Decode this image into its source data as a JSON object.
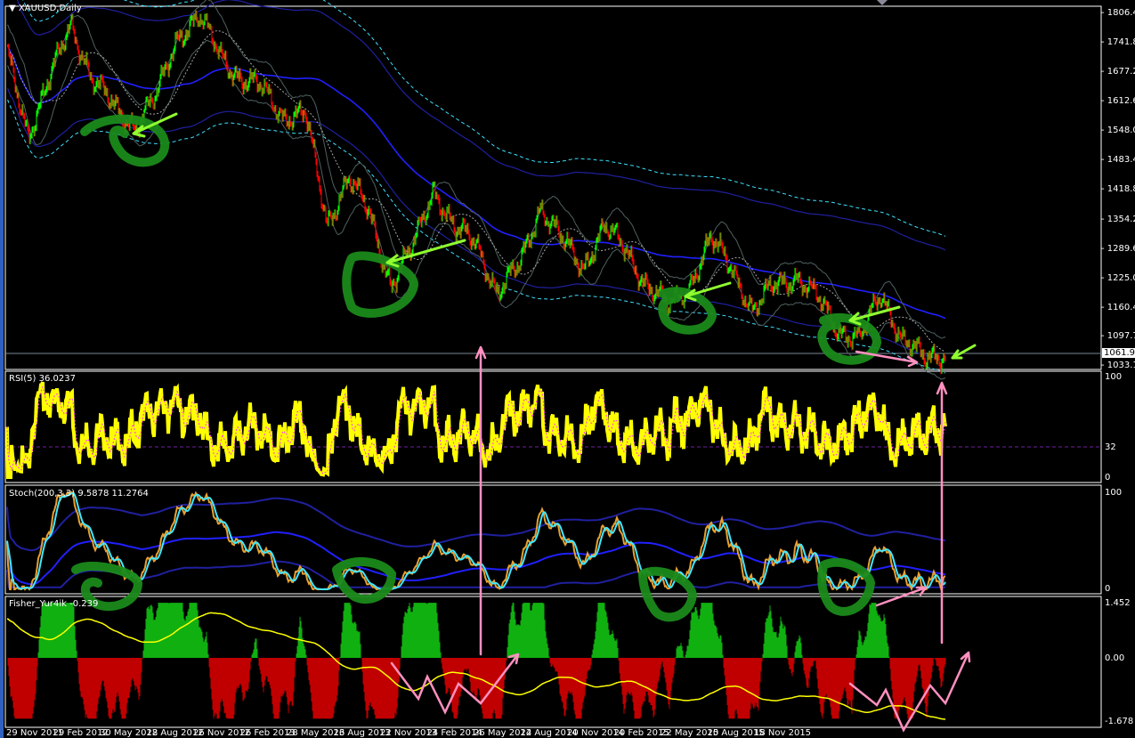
{
  "window": {
    "title": "XAUUSD,Daily"
  },
  "panels": {
    "rsi": {
      "label": "RSI(5) 36.0237",
      "axis": [
        "100",
        "32",
        "0"
      ]
    },
    "stoch": {
      "label": "Stoch(200,3,3) 9.5878 11.2764",
      "axis": [
        "100",
        "0"
      ]
    },
    "fisher": {
      "label": "Fisher_Yur4ik -0.239",
      "axis": [
        "1.452",
        "0.00",
        "-1.678"
      ]
    }
  },
  "colors": {
    "bull": "#00ff00",
    "bear": "#ff0000",
    "rsi": "#ffff00",
    "stoch_main": "#e8a030",
    "stoch_signal": "#40e8ff",
    "ma": "#2020ff",
    "envelope": "#40e0ff",
    "fisher_pos": "#10b010",
    "fisher_neg": "#c00000",
    "annotation_circle": "#1a8a1a",
    "annotation_arrow_green": "#90ff30",
    "annotation_arrow_pink": "#ff90c0"
  },
  "chart_data": {
    "type": "candlestick",
    "symbol": "XAUUSD",
    "timeframe": "Daily",
    "current_price": "1061.95",
    "price_axis": [
      "1806.40",
      "1741.80",
      "1677.20",
      "1612.60",
      "1548.00",
      "1483.40",
      "1418.80",
      "1354.20",
      "1289.60",
      "1225.00",
      "1160.40",
      "1097.70",
      "1033.10"
    ],
    "ylim": [
      1033.1,
      1806.4
    ],
    "time_axis": [
      "29 Nov 2011",
      "29 Feb 2012",
      "30 May 2012",
      "28 Aug 2012",
      "26 Nov 2012",
      "26 Feb 2013",
      "28 May 2013",
      "26 Aug 2013",
      "22 Nov 2013",
      "24 Feb 2014",
      "26 May 2014",
      "22 Aug 2014",
      "20 Nov 2014",
      "20 Feb 2015",
      "22 May 2015",
      "20 Aug 2015",
      "18 Nov 2015"
    ],
    "approx_closes": [
      [
        "29 Nov 2011",
        1718
      ],
      [
        "Dec 2011",
        1543
      ],
      [
        "Jan 2012",
        1660
      ],
      [
        "Feb 2012",
        1787
      ],
      [
        "Mar 2012",
        1660
      ],
      [
        "Apr 2012",
        1601
      ],
      [
        "May 2012",
        1562
      ],
      [
        "Jul 2012",
        1621
      ],
      [
        "Aug 2012",
        1758
      ],
      [
        "Oct 2012",
        1797
      ],
      [
        "Nov 2012",
        1718
      ],
      [
        "Dec 2012",
        1660
      ],
      [
        "Feb 2013",
        1640
      ],
      [
        "Feb 2013",
        1582
      ],
      [
        "Mar 2013",
        1582
      ],
      [
        "Apr 2013",
        1347
      ],
      [
        "May 2013",
        1445
      ],
      [
        "May 2013",
        1367
      ],
      [
        "Jun 2013",
        1211
      ],
      [
        "Jul 2013",
        1289
      ],
      [
        "Aug 2013",
        1425
      ],
      [
        "Sep 2013",
        1328
      ],
      [
        "Nov 2013",
        1308
      ],
      [
        "Dec 2013",
        1191
      ],
      [
        "Jan 2014",
        1250
      ],
      [
        "Mar 2014",
        1386
      ],
      [
        "Apr 2014",
        1308
      ],
      [
        "Jun 2014",
        1250
      ],
      [
        "Jul 2014",
        1338
      ],
      [
        "Aug 2014",
        1289
      ],
      [
        "Oct 2014",
        1211
      ],
      [
        "Nov 2014",
        1162
      ],
      [
        "Dec 2014",
        1211
      ],
      [
        "Jan 2015",
        1308
      ],
      [
        "Feb 2015",
        1250
      ],
      [
        "Mar 2015",
        1152
      ],
      [
        "May 2015",
        1211
      ],
      [
        "Jun 2015",
        1230
      ],
      [
        "Jul 2015",
        1181
      ],
      [
        "Jul 2015",
        1113
      ],
      [
        "Aug 2015",
        1093
      ],
      [
        "Oct 2015",
        1191
      ],
      [
        "Nov 2015",
        1093
      ],
      [
        "Dec 2015",
        1045
      ],
      [
        "Dec 2015",
        1064
      ]
    ],
    "indicators": [
      "RSI(5)",
      "Stoch(200,3,3)",
      "Fisher_Yur4ik"
    ],
    "grid": false
  }
}
